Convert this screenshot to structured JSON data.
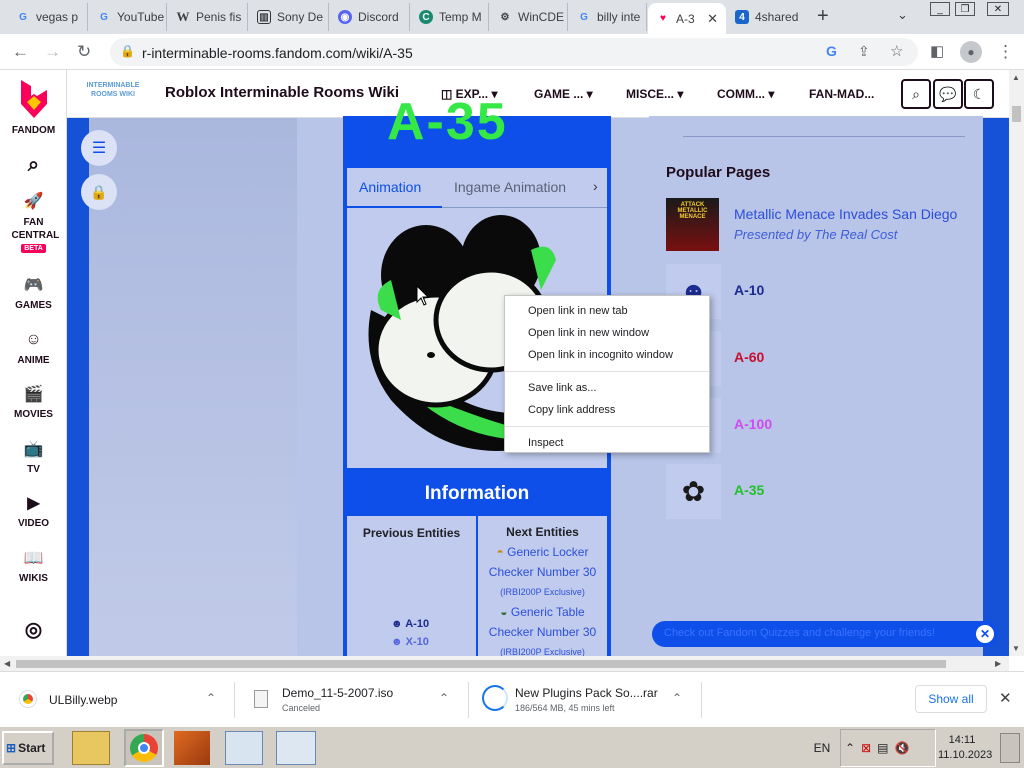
{
  "tabs": [
    {
      "title": "vegas p",
      "icon": "google-icon"
    },
    {
      "title": "YouTube",
      "icon": "google-icon"
    },
    {
      "title": "Penis fis",
      "icon": "wikipedia-icon"
    },
    {
      "title": "Sony De",
      "icon": "columns-icon"
    },
    {
      "title": "Discord",
      "icon": "discord-icon"
    },
    {
      "title": "Temp M",
      "icon": "tempmail-icon"
    },
    {
      "title": "WinCDE",
      "icon": "gear-icon"
    },
    {
      "title": "billy inte",
      "icon": "google-icon"
    },
    {
      "title": "A-3",
      "icon": "fandom-icon",
      "active": true
    },
    {
      "title": "4shared",
      "icon": "4shared-icon"
    }
  ],
  "address": {
    "url": "r-interminable-rooms.fandom.com/wiki/A-35"
  },
  "rail": {
    "logo_label": "FANDOM",
    "items": [
      {
        "label": "FAN CENTRAL",
        "badge": "BETA"
      },
      {
        "label": "GAMES"
      },
      {
        "label": "ANIME"
      },
      {
        "label": "MOVIES"
      },
      {
        "label": "TV"
      },
      {
        "label": "VIDEO"
      },
      {
        "label": "WIKIS"
      }
    ]
  },
  "wiki": {
    "logo_text": "INTERMINABLE ROOMS WIKI",
    "title": "Roblox Interminable Rooms Wiki",
    "nav": [
      "EXP...",
      "GAME ...",
      "MISCE...",
      "COMM...",
      "FAN-MAD..."
    ]
  },
  "infobox": {
    "tabs": [
      "Animation",
      "Ingame Animation"
    ],
    "section_title": "Information",
    "col_prev": "Previous Entities",
    "col_next": "Next Entities",
    "prev_entities": [
      "A-10",
      "X-10"
    ],
    "next_entities": [
      {
        "name": "Generic Locker Checker Number 30",
        "note": "(IRBI200P Exclusive)"
      },
      {
        "name": "Generic Table Checker Number 30",
        "note": "(IRBI200P Exclusive)"
      }
    ]
  },
  "context_menu": {
    "items": [
      "Open link in new tab",
      "Open link in new window",
      "Open link in incognito window",
      "Save link as...",
      "Copy link address",
      "Inspect"
    ]
  },
  "popular": {
    "heading": "Popular Pages",
    "items": [
      {
        "title": "Metallic Menace Invades San Diego",
        "subtitle": "Presented by The Real Cost",
        "color": "#2c4fd8"
      },
      {
        "title": "A-10",
        "color": "#1c2b8f"
      },
      {
        "title": "A-60",
        "color": "#c8102e"
      },
      {
        "title": "A-100",
        "color": "#d04cf0"
      },
      {
        "title": "A-35",
        "color": "#22c02a"
      }
    ]
  },
  "banner": {
    "text": "Check out Fandom Quizzes and challenge your friends!"
  },
  "downloads": [
    {
      "name": "ULBilly.webp",
      "status": ""
    },
    {
      "name": "Demo_11-5-2007.iso",
      "status": "Canceled"
    },
    {
      "name": "New Plugins Pack So....rar",
      "status": "186/564 MB, 45 mins left"
    }
  ],
  "downloads_show_all": "Show all",
  "taskbar": {
    "start": "Start",
    "lang": "EN",
    "time": "14:11",
    "date": "11.10.2023"
  }
}
